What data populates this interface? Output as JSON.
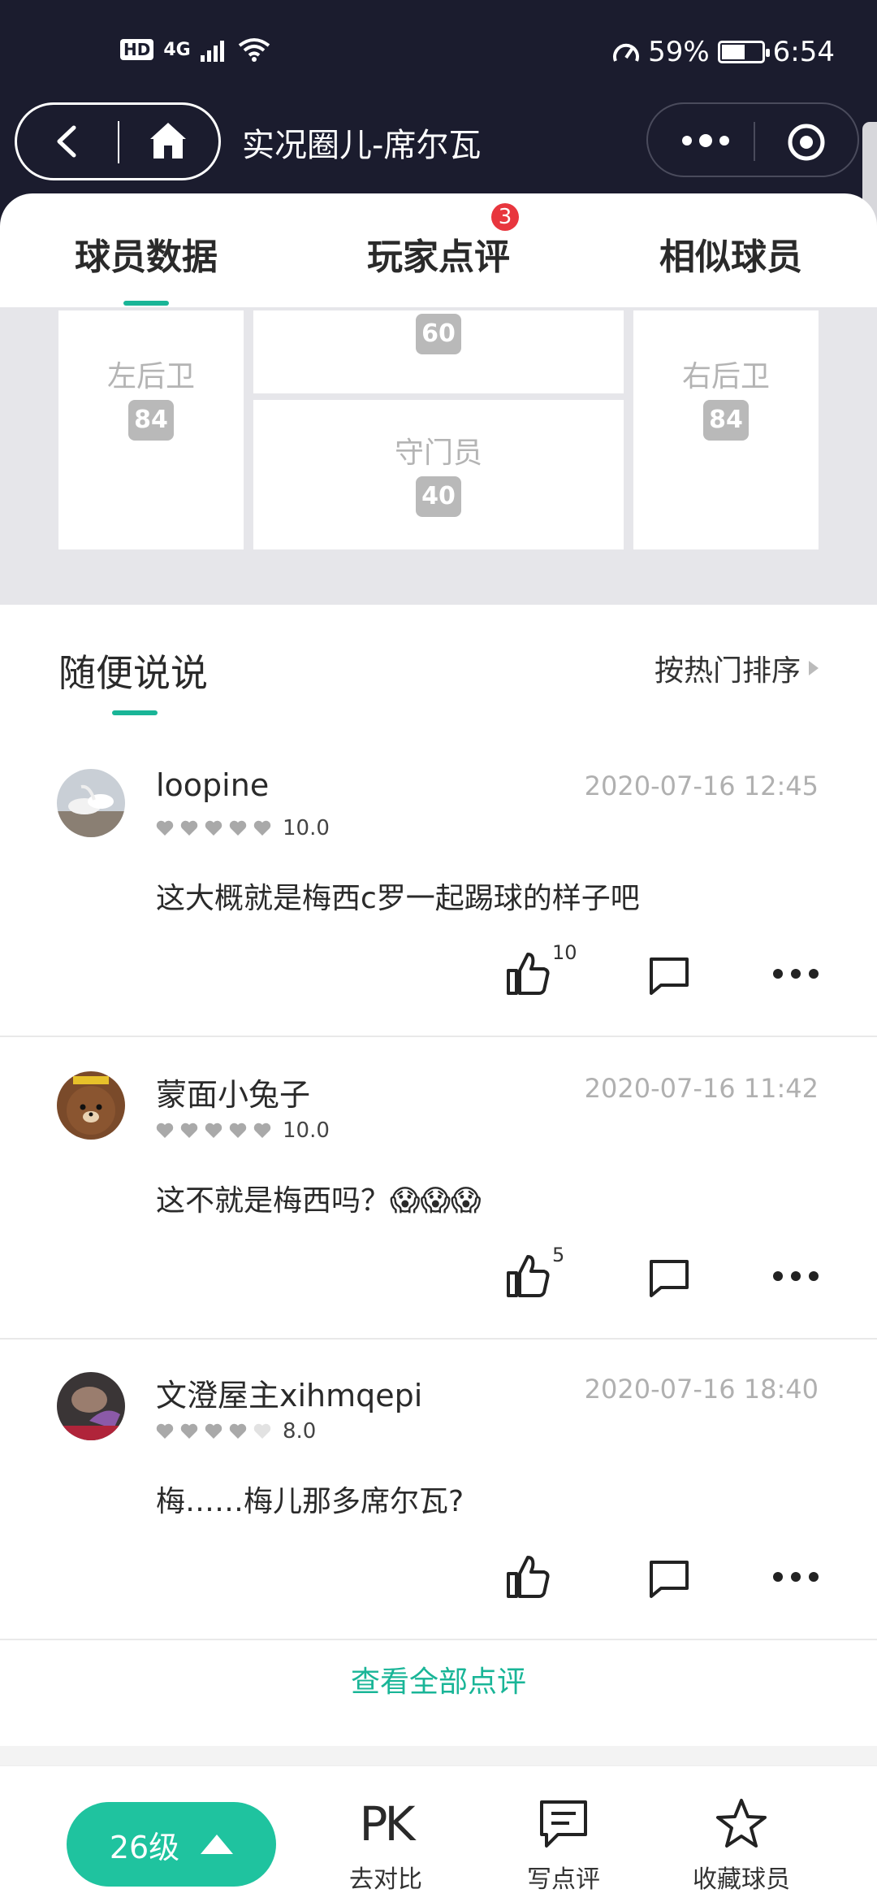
{
  "status_bar": {
    "hd": "HD",
    "network": "4G",
    "battery": "59%",
    "battery_level": 0.59,
    "time": "6:54"
  },
  "header": {
    "title": "实况圈儿-席尔瓦"
  },
  "tabs": {
    "items": [
      "球员数据",
      "玩家点评",
      "相似球员"
    ],
    "active": 0,
    "badge": "3"
  },
  "formation": {
    "top_value": "60",
    "left_label": "左后卫",
    "left_value": "84",
    "center_label": "守门员",
    "center_value": "40",
    "right_label": "右后卫",
    "right_value": "84"
  },
  "comments_section": {
    "title": "随便说说",
    "sort_label": "按热门排序",
    "view_all": "查看全部点评"
  },
  "comments": [
    {
      "user": "loopine",
      "time": "2020-07-16 12:45",
      "score": "10.0",
      "stars": 5,
      "text": "这大概就是梅西c罗一起踢球的样子吧",
      "likes": "10"
    },
    {
      "user": "蒙面小兔子",
      "time": "2020-07-16 11:42",
      "score": "10.0",
      "stars": 5,
      "text": "这不就是梅西吗？😱😱😱",
      "likes": "5"
    },
    {
      "user": "文澄屋主xihmqepi",
      "time": "2020-07-16 18:40",
      "score": "8.0",
      "stars": 4,
      "text": "梅……梅儿那多席尔瓦?",
      "likes": ""
    }
  ],
  "bottom_bar": {
    "level": "26级",
    "pk_mark": "PK",
    "compare": "去对比",
    "write_review": "写点评",
    "favorite": "收藏球员"
  },
  "colors": {
    "accent": "#19b597",
    "header_bg": "#1b1c2e",
    "badge": "#e8363e"
  }
}
